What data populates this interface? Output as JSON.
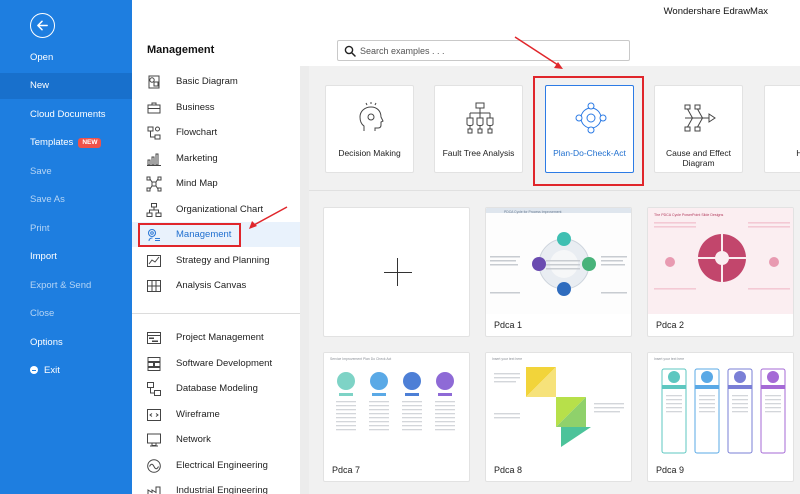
{
  "app_title": "Wondershare EdrawMax",
  "left_nav": {
    "items": [
      {
        "label": "Open"
      },
      {
        "label": "New"
      },
      {
        "label": "Cloud Documents"
      },
      {
        "label": "Templates",
        "badge": "NEW"
      },
      {
        "label": "Save"
      },
      {
        "label": "Save As"
      },
      {
        "label": "Print"
      },
      {
        "label": "Import"
      },
      {
        "label": "Export & Send"
      },
      {
        "label": "Close"
      },
      {
        "label": "Options"
      },
      {
        "label": "Exit"
      }
    ],
    "active": "New"
  },
  "header": {
    "section_title": "Management",
    "search_placeholder": "Search examples . . ."
  },
  "categories": {
    "group1": [
      {
        "label": "Basic Diagram",
        "icon": "basic-diagram-icon"
      },
      {
        "label": "Business",
        "icon": "briefcase-icon"
      },
      {
        "label": "Flowchart",
        "icon": "flowchart-icon"
      },
      {
        "label": "Marketing",
        "icon": "bar-chart-icon"
      },
      {
        "label": "Mind Map",
        "icon": "mind-map-icon"
      },
      {
        "label": "Organizational Chart",
        "icon": "org-chart-icon"
      },
      {
        "label": "Management",
        "icon": "management-icon"
      },
      {
        "label": "Strategy and Planning",
        "icon": "line-chart-icon"
      },
      {
        "label": "Analysis Canvas",
        "icon": "canvas-grid-icon"
      }
    ],
    "group2": [
      {
        "label": "Project Management",
        "icon": "gantt-icon"
      },
      {
        "label": "Software Development",
        "icon": "software-icon"
      },
      {
        "label": "Database Modeling",
        "icon": "database-icon"
      },
      {
        "label": "Wireframe",
        "icon": "wireframe-icon"
      },
      {
        "label": "Network",
        "icon": "network-icon"
      },
      {
        "label": "Electrical Engineering",
        "icon": "electrical-icon"
      },
      {
        "label": "Industrial Engineering",
        "icon": "industrial-icon"
      }
    ],
    "selected": "Management"
  },
  "templates": [
    {
      "label": "Decision Making",
      "icon": "head-icon"
    },
    {
      "label": "Fault Tree Analysis",
      "icon": "fault-tree-icon"
    },
    {
      "label": "Plan-Do-Check-Act",
      "icon": "pdca-cycle-icon"
    },
    {
      "label": "Cause and Effect Diagram",
      "icon": "fishbone-icon"
    },
    {
      "label": "House",
      "icon": "house-of-quality-icon"
    }
  ],
  "selected_template": "Plan-Do-Check-Act",
  "examples": [
    {
      "label": "Pdca 1",
      "thumb_title": "PDCA Cycle for Process Improvement"
    },
    {
      "label": "Pdca 2",
      "thumb_title": "The PDCA Cycle PowerPoint Slide Designs"
    },
    {
      "label": "Pdca 7",
      "thumb_title": "Service Improvement Plan Do Check Act"
    },
    {
      "label": "Pdca 8",
      "thumb_title": "Insert your text here"
    },
    {
      "label": "Pdca 9",
      "thumb_title": "Insert your text here"
    }
  ],
  "colors": {
    "nav_blue": "#1e7ee0",
    "accent_blue": "#2c7be5",
    "annotation_red": "#e0262b",
    "badge_red": "#f0524a"
  }
}
